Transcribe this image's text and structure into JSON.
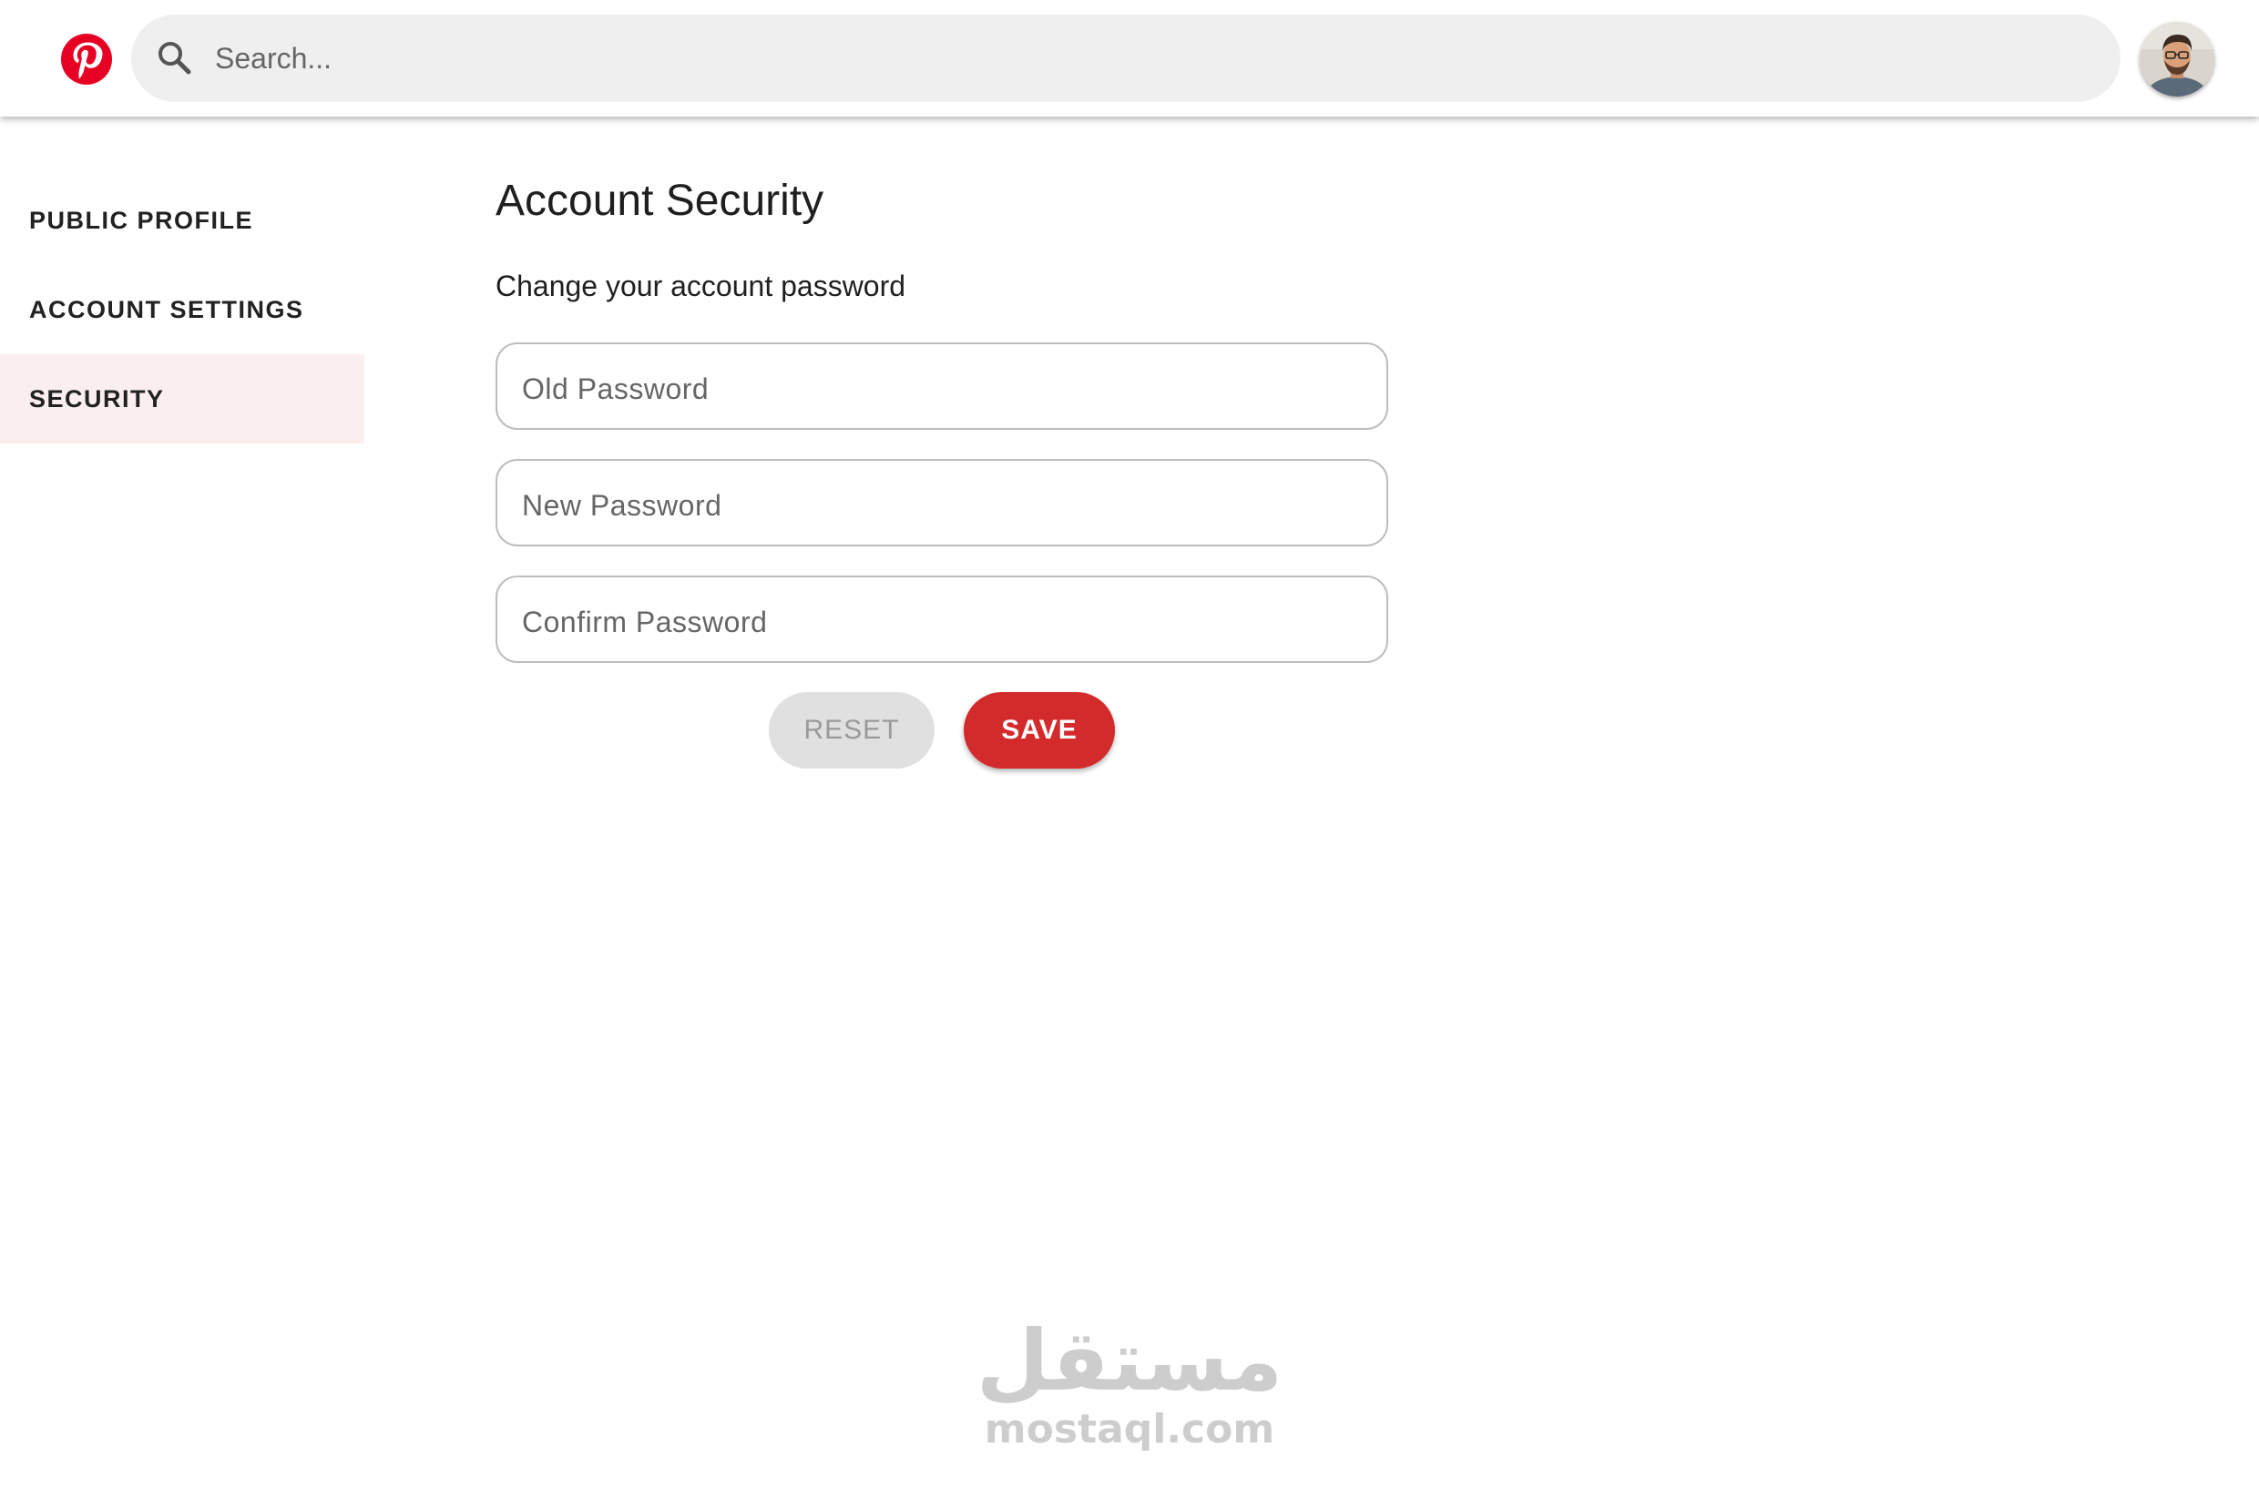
{
  "header": {
    "logo_icon": "pinterest-logo-icon",
    "brand_color": "#e60023",
    "search": {
      "icon": "search-icon",
      "placeholder": "Search...",
      "value": ""
    },
    "avatar_icon": "user-avatar"
  },
  "sidebar": {
    "items": [
      {
        "label": "PUBLIC PROFILE",
        "active": false
      },
      {
        "label": "ACCOUNT SETTINGS",
        "active": false
      },
      {
        "label": "SECURITY",
        "active": true
      }
    ],
    "active_bg": "#fbeeee"
  },
  "main": {
    "title": "Account Security",
    "subtitle": "Change your account password",
    "fields": [
      {
        "placeholder": "Old Password",
        "value": ""
      },
      {
        "placeholder": "New Password",
        "value": ""
      },
      {
        "placeholder": "Confirm Password",
        "value": ""
      }
    ],
    "buttons": {
      "reset_label": "RESET",
      "save_label": "SAVE",
      "save_color": "#d32b2b"
    }
  },
  "watermark": {
    "arabic": "مستقل",
    "latin": "mostaql.com"
  }
}
